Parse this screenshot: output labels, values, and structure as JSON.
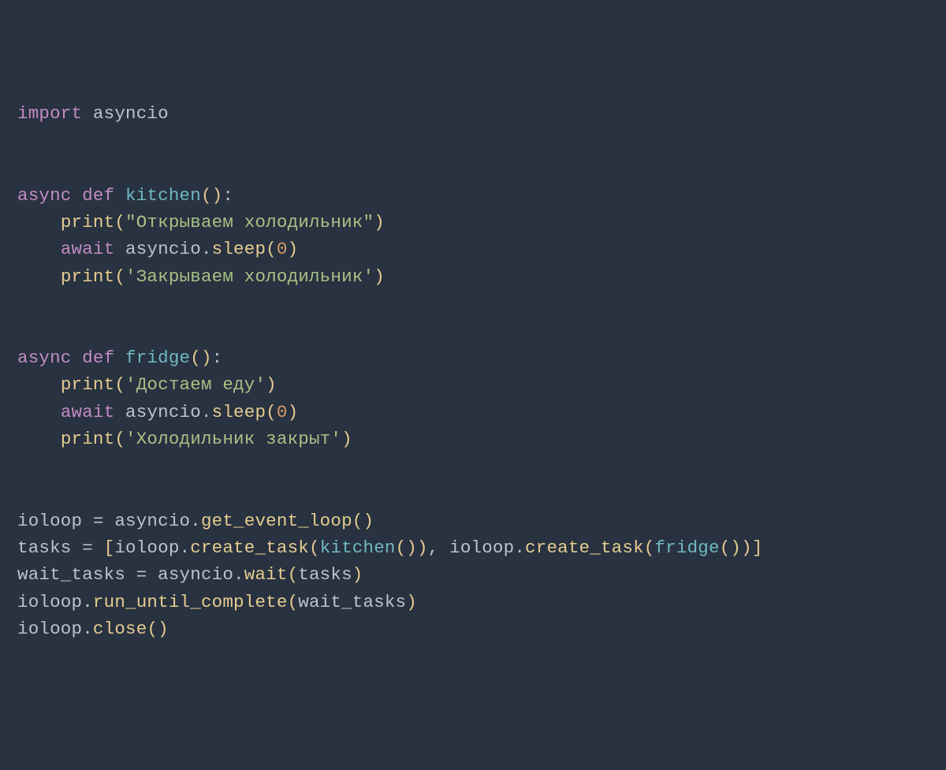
{
  "code": {
    "lines": [
      [
        {
          "t": "import ",
          "c": "keyword"
        },
        {
          "t": "asyncio",
          "c": "module"
        }
      ],
      [],
      [],
      [
        {
          "t": "async ",
          "c": "keyword"
        },
        {
          "t": "def ",
          "c": "keyword"
        },
        {
          "t": "kitchen",
          "c": "defname"
        },
        {
          "t": "()",
          "c": "paren"
        },
        {
          "t": ":",
          "c": "punct"
        }
      ],
      [
        {
          "t": "    ",
          "c": "module"
        },
        {
          "t": "print",
          "c": "call"
        },
        {
          "t": "(",
          "c": "paren"
        },
        {
          "t": "\"Открываем холодильник\"",
          "c": "string"
        },
        {
          "t": ")",
          "c": "paren"
        }
      ],
      [
        {
          "t": "    ",
          "c": "module"
        },
        {
          "t": "await ",
          "c": "keyword"
        },
        {
          "t": "asyncio",
          "c": "module"
        },
        {
          "t": ".",
          "c": "punct"
        },
        {
          "t": "sleep",
          "c": "call"
        },
        {
          "t": "(",
          "c": "paren"
        },
        {
          "t": "0",
          "c": "number"
        },
        {
          "t": ")",
          "c": "paren"
        }
      ],
      [
        {
          "t": "    ",
          "c": "module"
        },
        {
          "t": "print",
          "c": "call"
        },
        {
          "t": "(",
          "c": "paren"
        },
        {
          "t": "'Закрываем холодильник'",
          "c": "string"
        },
        {
          "t": ")",
          "c": "paren"
        }
      ],
      [],
      [],
      [
        {
          "t": "async ",
          "c": "keyword"
        },
        {
          "t": "def ",
          "c": "keyword"
        },
        {
          "t": "fridge",
          "c": "defname"
        },
        {
          "t": "()",
          "c": "paren"
        },
        {
          "t": ":",
          "c": "punct"
        }
      ],
      [
        {
          "t": "    ",
          "c": "module"
        },
        {
          "t": "print",
          "c": "call"
        },
        {
          "t": "(",
          "c": "paren"
        },
        {
          "t": "'Достаем еду'",
          "c": "string"
        },
        {
          "t": ")",
          "c": "paren"
        }
      ],
      [
        {
          "t": "    ",
          "c": "module"
        },
        {
          "t": "await ",
          "c": "keyword"
        },
        {
          "t": "asyncio",
          "c": "module"
        },
        {
          "t": ".",
          "c": "punct"
        },
        {
          "t": "sleep",
          "c": "call"
        },
        {
          "t": "(",
          "c": "paren"
        },
        {
          "t": "0",
          "c": "number"
        },
        {
          "t": ")",
          "c": "paren"
        }
      ],
      [
        {
          "t": "    ",
          "c": "module"
        },
        {
          "t": "print",
          "c": "call"
        },
        {
          "t": "(",
          "c": "paren"
        },
        {
          "t": "'Холодильник закрыт'",
          "c": "string"
        },
        {
          "t": ")",
          "c": "paren"
        }
      ],
      [],
      [],
      [
        {
          "t": "ioloop ",
          "c": "module"
        },
        {
          "t": "=",
          "c": "punct"
        },
        {
          "t": " asyncio",
          "c": "module"
        },
        {
          "t": ".",
          "c": "punct"
        },
        {
          "t": "get_event_loop",
          "c": "call"
        },
        {
          "t": "()",
          "c": "paren"
        }
      ],
      [
        {
          "t": "tasks ",
          "c": "module"
        },
        {
          "t": "=",
          "c": "punct"
        },
        {
          "t": " ",
          "c": "module"
        },
        {
          "t": "[",
          "c": "paren"
        },
        {
          "t": "ioloop",
          "c": "module"
        },
        {
          "t": ".",
          "c": "punct"
        },
        {
          "t": "create_task",
          "c": "call"
        },
        {
          "t": "(",
          "c": "paren"
        },
        {
          "t": "kitchen",
          "c": "callteal"
        },
        {
          "t": "())",
          "c": "paren"
        },
        {
          "t": ",",
          "c": "punct"
        },
        {
          "t": " ioloop",
          "c": "module"
        },
        {
          "t": ".",
          "c": "punct"
        },
        {
          "t": "create_task",
          "c": "call"
        },
        {
          "t": "(",
          "c": "paren"
        },
        {
          "t": "fridge",
          "c": "callteal"
        },
        {
          "t": "())",
          "c": "paren"
        },
        {
          "t": "]",
          "c": "paren"
        }
      ],
      [
        {
          "t": "wait_tasks ",
          "c": "module"
        },
        {
          "t": "=",
          "c": "punct"
        },
        {
          "t": " asyncio",
          "c": "module"
        },
        {
          "t": ".",
          "c": "punct"
        },
        {
          "t": "wait",
          "c": "call"
        },
        {
          "t": "(",
          "c": "paren"
        },
        {
          "t": "tasks",
          "c": "module"
        },
        {
          "t": ")",
          "c": "paren"
        }
      ],
      [
        {
          "t": "ioloop",
          "c": "module"
        },
        {
          "t": ".",
          "c": "punct"
        },
        {
          "t": "run_until_complete",
          "c": "call"
        },
        {
          "t": "(",
          "c": "paren"
        },
        {
          "t": "wait_tasks",
          "c": "module"
        },
        {
          "t": ")",
          "c": "paren"
        }
      ],
      [
        {
          "t": "ioloop",
          "c": "module"
        },
        {
          "t": ".",
          "c": "punct"
        },
        {
          "t": "close",
          "c": "call"
        },
        {
          "t": "()",
          "c": "paren"
        }
      ]
    ]
  }
}
